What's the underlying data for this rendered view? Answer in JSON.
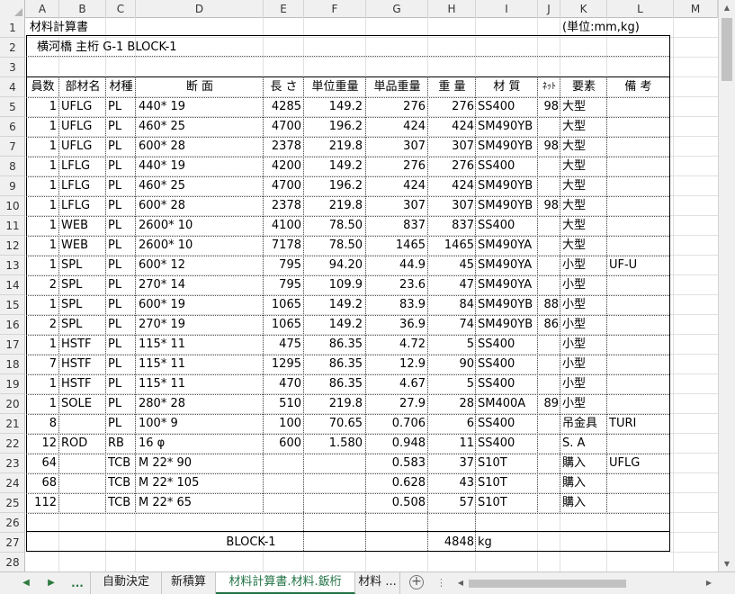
{
  "columns": [
    "A",
    "B",
    "C",
    "D",
    "E",
    "F",
    "G",
    "H",
    "I",
    "J",
    "K",
    "L",
    "M"
  ],
  "rows": [
    "1",
    "2",
    "3",
    "4",
    "5",
    "6",
    "7",
    "8",
    "9",
    "10",
    "11",
    "12",
    "13",
    "14",
    "15",
    "16",
    "17",
    "18",
    "19",
    "20",
    "21",
    "22",
    "23",
    "24",
    "25",
    "26",
    "27",
    "28"
  ],
  "title": "材料計算書",
  "unit_label": "(単位:mm,kg)",
  "subtitle": "横河橋 主桁 G-1 BLOCK-1",
  "headers": [
    "員数",
    "部材名",
    "材種",
    "断 面",
    "長 さ",
    "単位重量",
    "単品重量",
    "重 量",
    "材 質",
    "ﾈｯﾄ",
    "要素",
    "備 考"
  ],
  "table": [
    [
      "1",
      "UFLG",
      "PL",
      "440* 19",
      "4285",
      "149.2",
      "276",
      "276",
      "SS400",
      "98",
      "大型",
      ""
    ],
    [
      "1",
      "UFLG",
      "PL",
      "460* 25",
      "4700",
      "196.2",
      "424",
      "424",
      "SM490YB",
      "",
      "大型",
      ""
    ],
    [
      "1",
      "UFLG",
      "PL",
      "600* 28",
      "2378",
      "219.8",
      "307",
      "307",
      "SM490YB",
      "98",
      "大型",
      ""
    ],
    [
      "1",
      "LFLG",
      "PL",
      "440* 19",
      "4200",
      "149.2",
      "276",
      "276",
      "SS400",
      "",
      "大型",
      ""
    ],
    [
      "1",
      "LFLG",
      "PL",
      "460* 25",
      "4700",
      "196.2",
      "424",
      "424",
      "SM490YB",
      "",
      "大型",
      ""
    ],
    [
      "1",
      "LFLG",
      "PL",
      "600* 28",
      "2378",
      "219.8",
      "307",
      "307",
      "SM490YB",
      "98",
      "大型",
      ""
    ],
    [
      "1",
      "WEB",
      "PL",
      "2600* 10",
      "4100",
      "78.50",
      "837",
      "837",
      "SS400",
      "",
      "大型",
      ""
    ],
    [
      "1",
      "WEB",
      "PL",
      "2600* 10",
      "7178",
      "78.50",
      "1465",
      "1465",
      "SM490YA",
      "",
      "大型",
      ""
    ],
    [
      "1",
      "SPL",
      "PL",
      "600* 12",
      "795",
      "94.20",
      "44.9",
      "45",
      "SM490YA",
      "",
      "小型",
      "UF-U"
    ],
    [
      "2",
      "SPL",
      "PL",
      "270* 14",
      "795",
      "109.9",
      "23.6",
      "47",
      "SM490YA",
      "",
      "小型",
      ""
    ],
    [
      "1",
      "SPL",
      "PL",
      "600* 19",
      "1065",
      "149.2",
      "83.9",
      "84",
      "SM490YB",
      "88",
      "小型",
      ""
    ],
    [
      "2",
      "SPL",
      "PL",
      "270* 19",
      "1065",
      "149.2",
      "36.9",
      "74",
      "SM490YB",
      "86",
      "小型",
      ""
    ],
    [
      "1",
      "HSTF",
      "PL",
      "115* 11",
      "475",
      "86.35",
      "4.72",
      "5",
      "SS400",
      "",
      "小型",
      ""
    ],
    [
      "7",
      "HSTF",
      "PL",
      "115* 11",
      "1295",
      "86.35",
      "12.9",
      "90",
      "SS400",
      "",
      "小型",
      ""
    ],
    [
      "1",
      "HSTF",
      "PL",
      "115* 11",
      "470",
      "86.35",
      "4.67",
      "5",
      "SS400",
      "",
      "小型",
      ""
    ],
    [
      "1",
      "SOLE",
      "PL",
      "280* 28",
      "510",
      "219.8",
      "27.9",
      "28",
      "SM400A",
      "89",
      "小型",
      ""
    ],
    [
      "8",
      "",
      "PL",
      "100* 9",
      "100",
      "70.65",
      "0.706",
      "6",
      "SS400",
      "",
      "吊金具",
      "TURI"
    ],
    [
      "12",
      "ROD",
      "RB",
      "16 φ",
      "600",
      "1.580",
      "0.948",
      "11",
      "SS400",
      "",
      "S. A",
      ""
    ],
    [
      "64",
      "",
      "TCB",
      "M 22* 90",
      "",
      "",
      "0.583",
      "37",
      "S10T",
      "",
      "購入",
      "UFLG"
    ],
    [
      "68",
      "",
      "TCB",
      "M 22* 105",
      "",
      "",
      "0.628",
      "43",
      "S10T",
      "",
      "購入",
      ""
    ],
    [
      "112",
      "",
      "TCB",
      "M 22* 65",
      "",
      "",
      "0.508",
      "57",
      "S10T",
      "",
      "購入",
      ""
    ]
  ],
  "total_label": "BLOCK-1",
  "total_value": "4848",
  "total_unit": "kg",
  "sheet_nav": {
    "prev": "◀",
    "next": "▶",
    "more": "..."
  },
  "sheets": [
    "自動決定",
    "新積算",
    "材料計算書.材料.鈑桁",
    "材料 ..."
  ],
  "active_sheet_index": 2,
  "add_sheet": "+",
  "tab_separator": "⋮",
  "scroll": {
    "up": "▲",
    "down": "▼",
    "left": "◀",
    "right": "▶"
  },
  "colors": {
    "accent": "#217346",
    "header_bg": "#f0f0f0",
    "grid": "#e1e1e1"
  }
}
